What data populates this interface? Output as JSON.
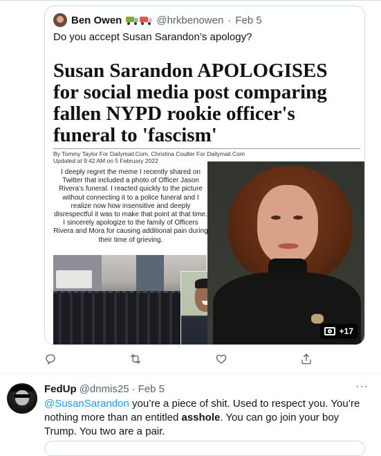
{
  "quoted_tweet": {
    "author_name": "Ben Owen",
    "emoji_icons": [
      "green-truck-icon",
      "red-truck-icon"
    ],
    "handle": "@hrkbenowen",
    "sep": "·",
    "date": "Feb 5",
    "text": "Do you accept Susan Sarandon’s apology?",
    "media_count": "+17"
  },
  "article": {
    "headline": "Susan Sarandon APOLOGISES for social media post comparing fallen NYPD rookie officer's funeral to 'fascism'",
    "byline_line1": "By Tommy Taylor For Dailymail.Com, Christina Coulter For Dailymail.Com",
    "byline_line2": "Updated at 9:42 AM on 5 February 2022",
    "statement": "I deeply regret the meme I recently shared on Twitter that included a photo of Officer Jason Rivera’s funeral. I reacted quickly to the picture without connecting it to a police funeral and I realize now how insensitive and deeply disrespectful it was to make that point at that time. I sincerely apologize to the family of Officers Rivera and Mora for causing additional pain during their time of grieving."
  },
  "actions": [
    "reply-icon",
    "retweet-icon",
    "like-icon",
    "share-icon"
  ],
  "reply": {
    "author_name": "FedUp",
    "handle": "@dnmis25",
    "sep": "·",
    "date": "Feb 5",
    "more": "···",
    "mention": "@SusanSarandon",
    "text_part1": " you’re a piece of shit.  Used to respect you.  You’re nothing more than an entitled ",
    "bold_word": "asshole",
    "text_part2": ".  You can go join your boy Trump.  You two are a pair."
  },
  "colors": {
    "accent": "#1d9bf0",
    "text": "#0f1419",
    "secondary": "#536471",
    "border": "#cfd9de"
  }
}
